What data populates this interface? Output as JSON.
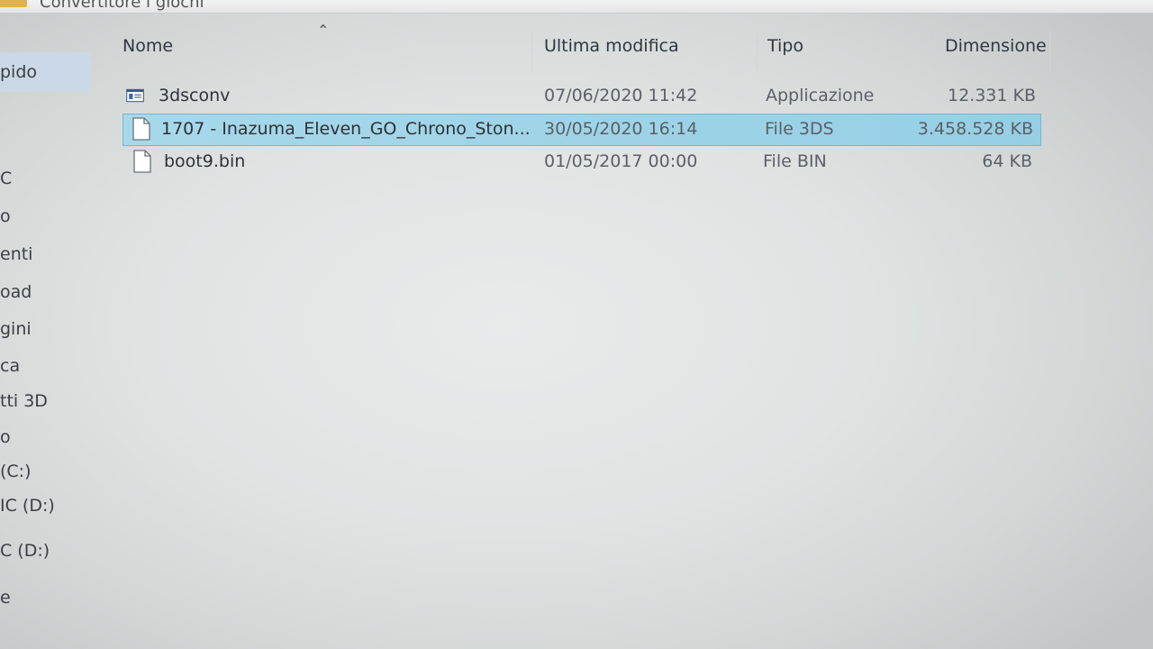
{
  "window": {
    "path_text": "Convertitore i giochi"
  },
  "sidebar": {
    "items": [
      {
        "label": "pido"
      },
      {
        "label": "C"
      },
      {
        "label": "o"
      },
      {
        "label": "enti"
      },
      {
        "label": "oad"
      },
      {
        "label": "gini"
      },
      {
        "label": "ca"
      },
      {
        "label": "tti 3D"
      },
      {
        "label": "o"
      },
      {
        "label": "(C:)"
      },
      {
        "label": "IC (D:)"
      },
      {
        "label": "C (D:)"
      },
      {
        "label": "e"
      }
    ]
  },
  "columns": {
    "name": "Nome",
    "modified": "Ultima modifica",
    "type": "Tipo",
    "size": "Dimensione"
  },
  "files": [
    {
      "name": "3dsconv",
      "modified": "07/06/2020 11:42",
      "type": "Applicazione",
      "size": "12.331 KB",
      "icon": "application-icon"
    },
    {
      "name": "1707 - Inazuma_Eleven_GO_Chrono_Ston...",
      "modified": "30/05/2020 16:14",
      "type": "File 3DS",
      "size": "3.458.528 KB",
      "icon": "file-icon"
    },
    {
      "name": "boot9.bin",
      "modified": "01/05/2017 00:00",
      "type": "File BIN",
      "size": "64 KB",
      "icon": "file-icon"
    }
  ]
}
